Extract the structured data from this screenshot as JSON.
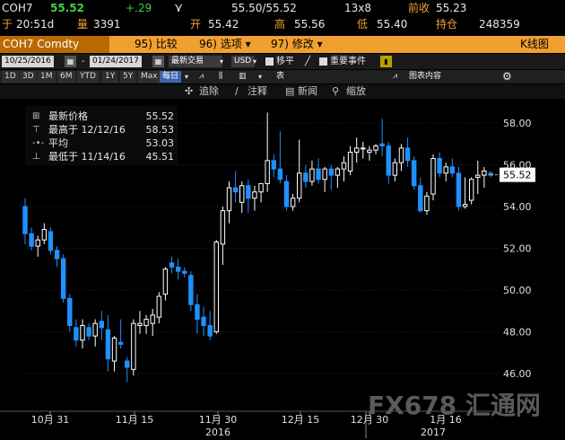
{
  "header": {
    "ticker": "COH7",
    "last": "55.52",
    "change": "+.29",
    "bid_ask": "55.50/55.52",
    "size": "13x8",
    "prev_close_label": "前收",
    "prev_close": "55.23",
    "time_prefix": "于",
    "time": "20:51d",
    "volume_label": "量",
    "volume": "3391",
    "open_label": "开",
    "open": "55.42",
    "high_label": "高",
    "high": "55.56",
    "low_label": "低",
    "low": "55.40",
    "oi_label": "持仓",
    "oi": "248359"
  },
  "command_bar": {
    "security": "COH7 Comdty",
    "compare": "95) 比较",
    "options": "96) 选项 ▾",
    "edit": "97) 修改 ▾",
    "chart_type": "K线图"
  },
  "toolbar": {
    "start_date": "10/25/2016",
    "end_date": "01/24/2017",
    "period": "最新交易",
    "currency": "USD",
    "smooth_label": "移平",
    "events_label": "重要事件"
  },
  "ranges": {
    "items": [
      "1D",
      "3D",
      "1M",
      "6M",
      "YTD",
      "1Y",
      "5Y",
      "Max"
    ],
    "interval": "每日",
    "table_label": "表",
    "chart_content_label": "图表内容"
  },
  "actions": {
    "zoom_in": "追除",
    "annotate": "注释",
    "news": "新闻",
    "zoom": "缩放"
  },
  "legend": {
    "rows": [
      {
        "label": "最新价格",
        "value": "55.52"
      },
      {
        "label": "最高于 12/12/16",
        "value": "58.53"
      },
      {
        "label": "平均",
        "value": "53.03"
      },
      {
        "label": "最低于 11/14/16",
        "value": "45.51"
      }
    ]
  },
  "watermark": "FX678 汇通网",
  "colors": {
    "up": "#ffffff",
    "down": "#1e90ff",
    "accent": "#f0a030",
    "last_tag": "#ffffff"
  },
  "chart_data": {
    "type": "candlestick",
    "ylim": [
      45,
      59
    ],
    "yticks": [
      "46.00",
      "48.00",
      "50.00",
      "52.00",
      "54.00",
      "56.00",
      "58.00"
    ],
    "ytick_values": [
      46,
      48,
      50,
      52,
      54,
      56,
      58
    ],
    "xtick_labels": [
      "10月 31",
      "11月 15",
      "11月 30",
      "12月 15",
      "12月 30",
      "1月 16"
    ],
    "year_labels": [
      "2016",
      "2017"
    ],
    "last_price_tag": "55.52",
    "ohlc": [
      [
        54.0,
        54.4,
        52.2,
        52.7
      ],
      [
        52.7,
        53.0,
        51.9,
        52.1
      ],
      [
        52.1,
        52.6,
        51.6,
        52.4
      ],
      [
        52.4,
        53.2,
        52.2,
        52.9
      ],
      [
        52.8,
        53.0,
        51.7,
        51.9
      ],
      [
        51.9,
        52.1,
        51.1,
        51.5
      ],
      [
        51.5,
        51.7,
        49.4,
        49.6
      ],
      [
        49.6,
        49.8,
        48.0,
        48.3
      ],
      [
        48.2,
        48.6,
        47.3,
        47.6
      ],
      [
        47.6,
        48.6,
        47.2,
        48.3
      ],
      [
        48.2,
        48.4,
        47.6,
        47.8
      ],
      [
        47.8,
        48.6,
        47.3,
        48.4
      ],
      [
        48.5,
        49.0,
        47.6,
        48.2
      ],
      [
        48.1,
        48.8,
        46.1,
        46.7
      ],
      [
        46.6,
        47.8,
        46.1,
        47.7
      ],
      [
        47.5,
        48.6,
        47.2,
        47.4
      ],
      [
        46.6,
        46.8,
        45.6,
        46.3
      ],
      [
        46.2,
        48.6,
        45.9,
        48.4
      ],
      [
        48.3,
        49.0,
        47.9,
        48.4
      ],
      [
        48.3,
        48.8,
        47.9,
        48.6
      ],
      [
        48.4,
        49.1,
        47.8,
        48.8
      ],
      [
        48.7,
        49.9,
        48.4,
        49.7
      ],
      [
        49.8,
        51.1,
        49.5,
        51.0
      ],
      [
        51.3,
        51.6,
        50.8,
        51.1
      ],
      [
        51.1,
        51.5,
        50.5,
        50.9
      ],
      [
        50.9,
        51.1,
        50.6,
        50.8
      ],
      [
        50.7,
        50.9,
        49.0,
        49.3
      ],
      [
        49.3,
        49.8,
        47.9,
        48.6
      ],
      [
        48.7,
        49.2,
        47.8,
        48.3
      ],
      [
        48.3,
        49.0,
        47.6,
        47.8
      ],
      [
        48.0,
        52.4,
        47.9,
        52.3
      ],
      [
        52.2,
        54.0,
        51.2,
        53.8
      ],
      [
        53.8,
        55.2,
        53.2,
        54.9
      ],
      [
        54.9,
        55.7,
        54.2,
        54.7
      ],
      [
        54.2,
        55.2,
        53.7,
        55.0
      ],
      [
        55.0,
        55.3,
        53.7,
        54.4
      ],
      [
        54.4,
        55.0,
        53.8,
        54.7
      ],
      [
        54.7,
        55.1,
        54.2,
        55.1
      ],
      [
        55.1,
        58.5,
        54.7,
        56.2
      ],
      [
        56.2,
        56.5,
        55.4,
        55.8
      ],
      [
        55.8,
        57.6,
        55.1,
        55.3
      ],
      [
        55.2,
        55.5,
        53.8,
        54.0
      ],
      [
        54.0,
        54.6,
        53.8,
        54.4
      ],
      [
        54.4,
        57.2,
        54.2,
        55.6
      ],
      [
        55.6,
        56.0,
        54.9,
        55.2
      ],
      [
        55.2,
        56.2,
        55.0,
        55.8
      ],
      [
        55.8,
        56.3,
        55.1,
        55.3
      ],
      [
        55.3,
        55.9,
        54.7,
        55.8
      ],
      [
        55.8,
        56.0,
        54.8,
        55.5
      ],
      [
        55.5,
        55.9,
        54.9,
        55.8
      ],
      [
        55.8,
        56.4,
        55.2,
        56.1
      ],
      [
        55.7,
        56.9,
        55.5,
        56.6
      ],
      [
        56.6,
        57.3,
        56.1,
        56.8
      ],
      [
        56.8,
        57.1,
        56.3,
        56.8
      ],
      [
        56.6,
        56.9,
        56.2,
        56.7
      ],
      [
        56.7,
        57.0,
        56.5,
        56.9
      ],
      [
        57.0,
        58.2,
        56.4,
        56.9
      ],
      [
        56.9,
        57.1,
        55.1,
        55.5
      ],
      [
        55.5,
        56.3,
        55.2,
        56.1
      ],
      [
        56.1,
        57.0,
        55.7,
        56.8
      ],
      [
        56.8,
        57.3,
        55.9,
        56.2
      ],
      [
        56.2,
        56.4,
        54.8,
        55.0
      ],
      [
        55.0,
        55.4,
        53.7,
        53.8
      ],
      [
        53.8,
        54.7,
        53.6,
        54.5
      ],
      [
        54.6,
        56.5,
        54.3,
        56.3
      ],
      [
        56.3,
        56.6,
        55.4,
        55.6
      ],
      [
        55.6,
        56.1,
        55.2,
        55.9
      ],
      [
        55.9,
        56.3,
        55.4,
        55.6
      ],
      [
        55.6,
        55.9,
        53.8,
        54.0
      ],
      [
        54.0,
        55.4,
        53.9,
        54.1
      ],
      [
        54.3,
        55.4,
        54.1,
        55.3
      ],
      [
        55.4,
        56.2,
        54.6,
        55.5
      ],
      [
        55.5,
        55.9,
        54.9,
        55.7
      ],
      [
        55.6,
        55.7,
        55.4,
        55.5
      ]
    ]
  }
}
